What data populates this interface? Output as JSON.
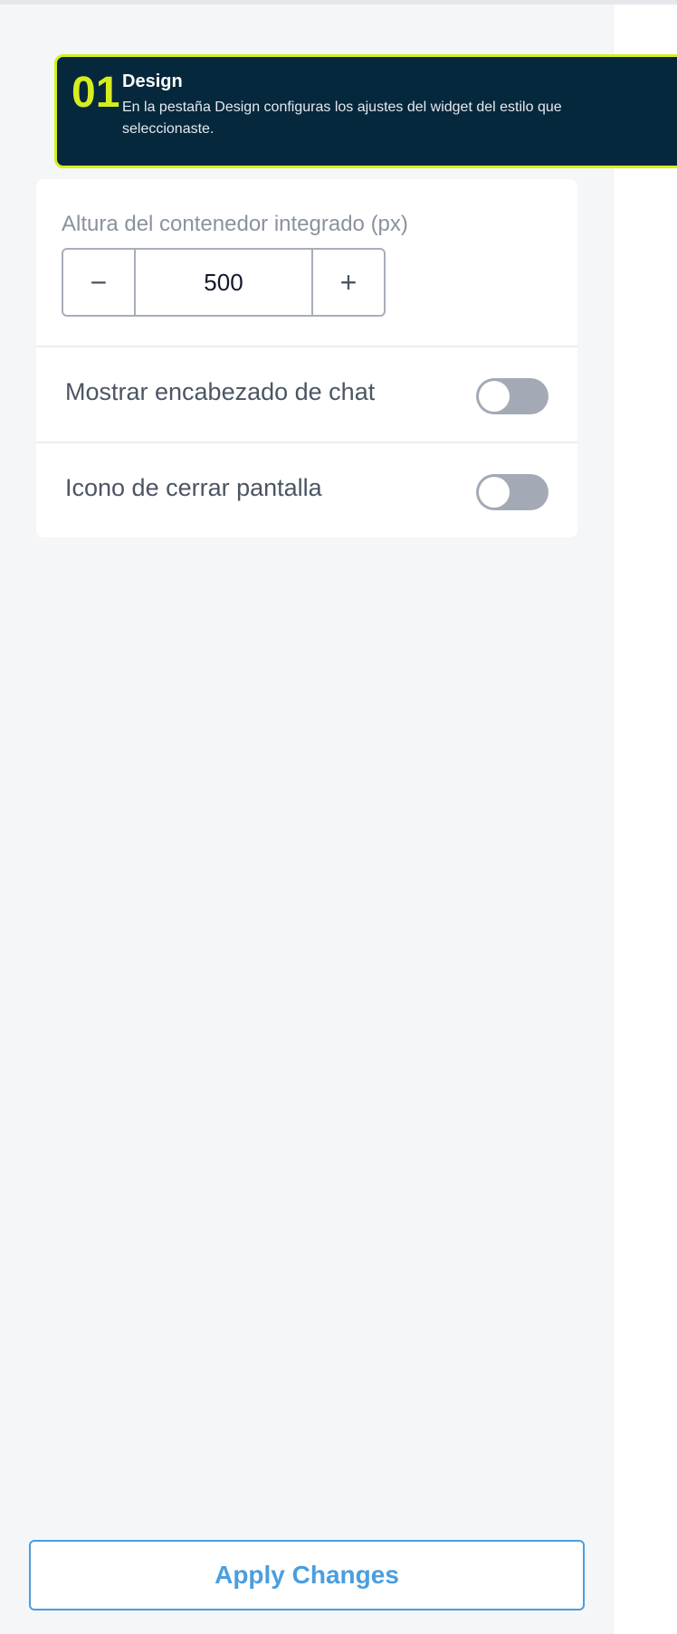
{
  "tooltip": {
    "step_number": "01",
    "title": "Design",
    "text": "En la pestaña Design configuras los ajustes del widget del estilo que seleccionaste.",
    "accent_color": "#d6ee1f",
    "background_color": "#06283d"
  },
  "settings": {
    "container_height": {
      "label": "Altura del contenedor integrado (px)",
      "value": "500",
      "decrement_icon": "minus-icon",
      "increment_icon": "plus-icon"
    },
    "show_chat_header": {
      "label": "Mostrar encabezado de chat",
      "enabled": false
    },
    "close_screen_icon": {
      "label": "Icono de cerrar pantalla",
      "enabled": false
    }
  },
  "footer": {
    "apply_label": "Apply Changes",
    "accent_color": "#4a9ee0"
  }
}
